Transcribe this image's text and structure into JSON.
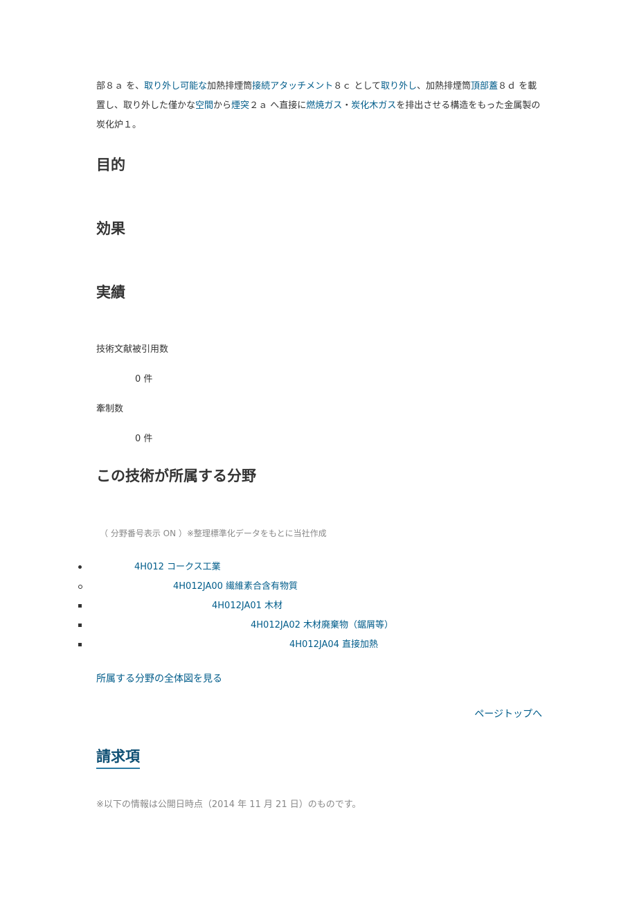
{
  "abstract": {
    "segments": [
      {
        "text": "部８ａ を、",
        "link": false
      },
      {
        "text": "取り外し可能な",
        "link": true
      },
      {
        "text": "加熱排煙筒",
        "link": false
      },
      {
        "text": "接続アタッチメント",
        "link": true
      },
      {
        "text": "８ｃ として",
        "link": false
      },
      {
        "text": "取り外し",
        "link": true
      },
      {
        "text": "、加熱排煙筒",
        "link": false
      },
      {
        "text": "頂部蓋",
        "link": true
      },
      {
        "text": "８ｄ を載置し、取り外した僅かな",
        "link": false
      },
      {
        "text": "空間",
        "link": true
      },
      {
        "text": "から",
        "link": false
      },
      {
        "text": "煙突",
        "link": true
      },
      {
        "text": "２ａ へ直接に",
        "link": false
      },
      {
        "text": "燃焼ガス",
        "link": true
      },
      {
        "text": "・",
        "link": false
      },
      {
        "text": "炭化木ガス",
        "link": true
      },
      {
        "text": "を排出させる構造をもった金属製の炭化炉１。",
        "link": false
      }
    ]
  },
  "sections": {
    "purpose": "目的",
    "effect": "効果",
    "results": "実績"
  },
  "results": {
    "citations_label": "技術文献被引用数",
    "citations_value": "0 件",
    "restraint_label": "牽制数",
    "restraint_value": "0 件"
  },
  "fields": {
    "heading": "この技術が所属する分野",
    "note": "（ 分野番号表示 ON ）※整理標準化データをもとに当社作成",
    "items": [
      {
        "bullet": "disc",
        "label": "4H012  コークス工業"
      },
      {
        "bullet": "circle",
        "label": "4H012JA00  繊維素合含有物質"
      },
      {
        "bullet": "square",
        "label": "4H012JA01  木材"
      },
      {
        "bullet": "square",
        "label": "4H012JA02  木材廃棄物（鋸屑等）"
      },
      {
        "bullet": "square",
        "label": "4H012JA04  直接加熱"
      }
    ],
    "view_all_link": "所属する分野の全体図を見る"
  },
  "page_top_link": "ページトップへ",
  "claims": {
    "heading": "請求項",
    "note": "※以下の情報は公開日時点（2014 年 11 月 21 日）のものです。"
  },
  "colors": {
    "link": "#005c8a",
    "text": "#333333",
    "note": "#888888",
    "claims_heading": "#0e4f73",
    "claims_underline": "#2a7aa3"
  }
}
